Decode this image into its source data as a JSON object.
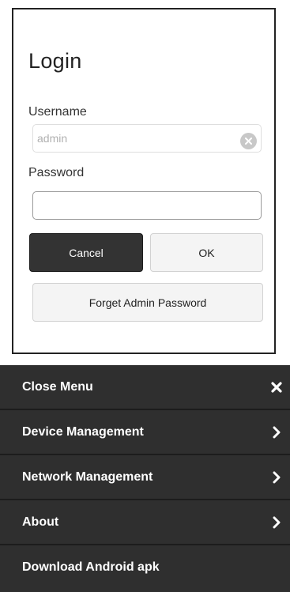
{
  "login": {
    "title": "Login",
    "username_label": "Username",
    "username_placeholder": "admin",
    "username_value": "",
    "password_label": "Password",
    "password_value": "",
    "cancel_label": "Cancel",
    "ok_label": "OK",
    "forget_label": "Forget Admin Password"
  },
  "menu": {
    "items": [
      {
        "label": "Close Menu",
        "icon": "close-icon"
      },
      {
        "label": "Device Management",
        "icon": "chevron-right-icon"
      },
      {
        "label": "Network Management",
        "icon": "chevron-right-icon"
      },
      {
        "label": "About",
        "icon": "chevron-right-icon"
      },
      {
        "label": "Download Android apk",
        "icon": ""
      }
    ]
  },
  "colors": {
    "menu_background": "#2f2f2f",
    "cancel_button": "#333333",
    "secondary_button": "#f4f4f4"
  }
}
